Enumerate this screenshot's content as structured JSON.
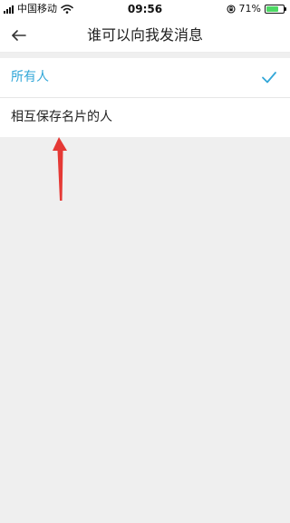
{
  "status_bar": {
    "carrier": "中国移动",
    "time": "09:56",
    "battery_percent_text": "71%",
    "battery_level": 0.71
  },
  "nav": {
    "title": "谁可以向我发消息",
    "back_icon": "arrow-left-icon"
  },
  "options": [
    {
      "label": "所有人",
      "selected": true
    },
    {
      "label": "相互保存名片的人",
      "selected": false
    }
  ],
  "colors": {
    "accent": "#32a7d8",
    "background": "#efefef",
    "annotation": "#e53935",
    "battery": "#4cd964"
  },
  "icons": {
    "selected": "checkmark-icon",
    "annotation": "red-arrow-annotation"
  }
}
